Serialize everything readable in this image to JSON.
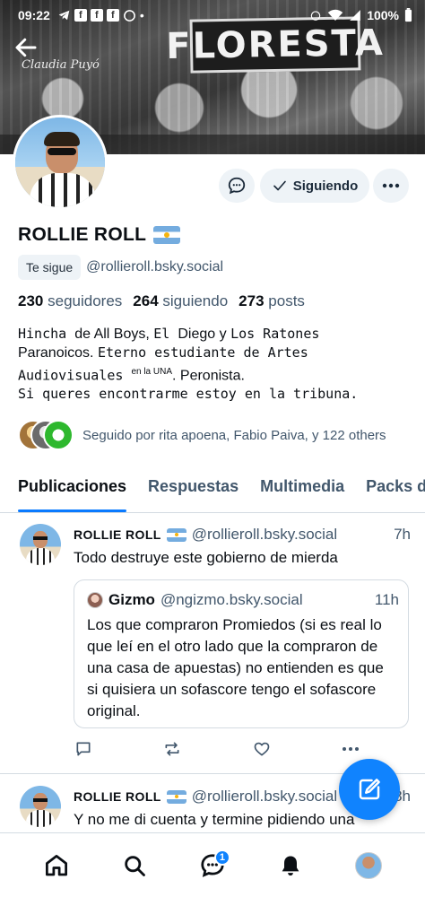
{
  "status_bar": {
    "time": "09:22",
    "battery": "100%"
  },
  "banner": {
    "sign_text": "FLORESTA",
    "script_text": "Claudia Puyó"
  },
  "profile": {
    "display_name": "ROLLIE ROLL",
    "follows_you_badge": "Te sigue",
    "handle": "@rollieroll.bsky.social",
    "followers_count": "230",
    "followers_label": "seguidores",
    "following_count": "264",
    "following_label": "siguiendo",
    "posts_count": "273",
    "posts_label": "posts",
    "bio_line1_a": "Hincha ",
    "bio_line1_b": "de All Boys, ",
    "bio_line1_c": "El ",
    "bio_line1_d": "Diego y ",
    "bio_line1_e": "Los Ratones",
    "bio_line2_a": "Paranoicos. ",
    "bio_line2_b": "Eterno estudiante de Artes",
    "bio_line3_a": "Audiovisuales ",
    "bio_line3_sup": "en la UNA",
    "bio_line3_b": ". Peronista.",
    "bio_line4": "Si queres encontrarme estoy en la tribuna.",
    "followed_by": "Seguido por rita apoena, Fabio Paiva, y 122 others"
  },
  "buttons": {
    "following_label": "Siguiendo"
  },
  "tabs": [
    {
      "label": "Publicaciones"
    },
    {
      "label": "Respuestas"
    },
    {
      "label": "Multimedia"
    },
    {
      "label": "Packs d"
    }
  ],
  "posts": [
    {
      "author": "ROLLIE ROLL",
      "handle": "@rollieroll.bsky.social",
      "time": "7h",
      "text": "Todo destruye este gobierno de mierda",
      "quote": {
        "author": "Gizmo",
        "handle": "@ngizmo.bsky.social",
        "time": "11h",
        "text": "Los que compraron Promiedos (si es real lo que leí en el otro lado que la compraron de una casa de apuestas) no entienden es que si quisiera un sofascore tengo el sofascore original."
      }
    },
    {
      "author": "ROLLIE ROLL",
      "handle": "@rollieroll.bsky.social",
      "time": "8h",
      "text": "Y no me di cuenta y termine pidiendo una"
    }
  ],
  "nav": {
    "chat_badge": "1"
  },
  "colors": {
    "accent": "#1083fe",
    "muted_text": "#42576c",
    "divider": "#d4dbe2",
    "chip_bg": "#eef3f7"
  }
}
